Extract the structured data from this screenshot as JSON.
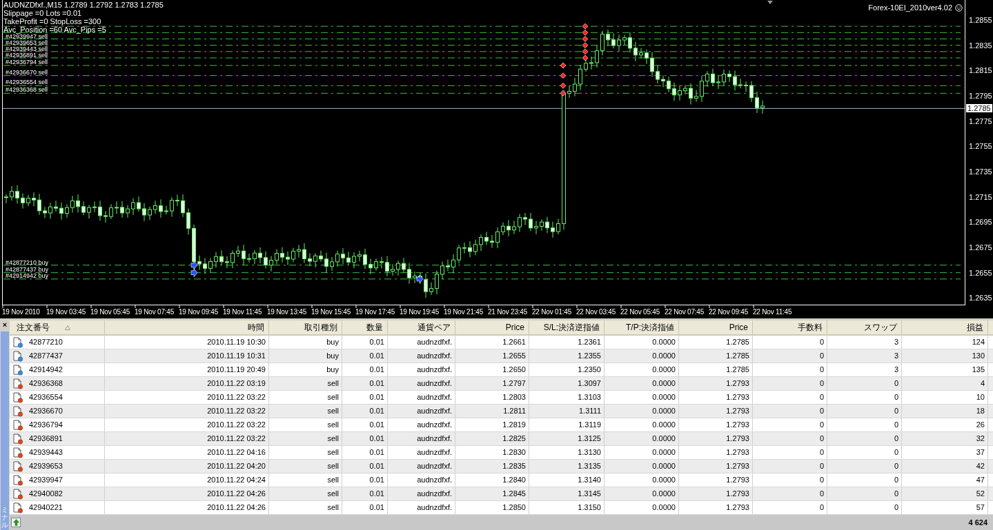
{
  "chart": {
    "symbol_line": "AUDNZDfxf.,M15  1.2789 1.2792 1.2783 1.2785",
    "info_lines": [
      "Slippage =0 Lots =0.01",
      "TakeProfit =0 StopLoss =300",
      "Avc_Position =60 Avc_Pips =5"
    ],
    "expert": "Forex-10EI_2010ver4.02",
    "price_ticks": [
      "1.2855",
      "1.2835",
      "1.2815",
      "1.2795",
      "1.2775",
      "1.2755",
      "1.2735",
      "1.2715",
      "1.2695",
      "1.2675",
      "1.2655",
      "1.2635"
    ],
    "current_price": "1.2785",
    "order_labels": [
      "#42939947 sell",
      "#42939653 sell",
      "#42939443 sell",
      "#42936891 sell",
      "#42936794 sell",
      "#42936670 sell",
      "#42936554 sell",
      "#42936368 sell",
      "#42877210 buy",
      "#42877437 buy",
      "#42914942 buy"
    ],
    "time_ticks": [
      "19 Nov 2010",
      "19 Nov 03:45",
      "19 Nov 05:45",
      "19 Nov 07:45",
      "19 Nov 09:45",
      "19 Nov 11:45",
      "19 Nov 13:45",
      "19 Nov 15:45",
      "19 Nov 17:45",
      "19 Nov 19:45",
      "19 Nov 21:45",
      "21 Nov 23:45",
      "22 Nov 01:45",
      "22 Nov 03:45",
      "22 Nov 05:45",
      "22 Nov 07:45",
      "22 Nov 09:45",
      "22 Nov 11:45"
    ]
  },
  "terminal": {
    "close": "×",
    "side_tab": "ミナル",
    "columns": [
      {
        "label": "注文番号",
        "sorted": true
      },
      {
        "label": "時間",
        "sorted": false
      },
      {
        "label": "取引種別",
        "sorted": false
      },
      {
        "label": "数量",
        "sorted": false
      },
      {
        "label": "通貨ペア",
        "sorted": false
      },
      {
        "label": "Price",
        "sorted": false
      },
      {
        "label": "S/L:決済逆指値",
        "sorted": false
      },
      {
        "label": "T/P:決済指値",
        "sorted": false
      },
      {
        "label": "Price",
        "sorted": false
      },
      {
        "label": "手数料",
        "sorted": false
      },
      {
        "label": "スワップ",
        "sorted": false
      },
      {
        "label": "損益",
        "sorted": false
      }
    ],
    "rows": [
      {
        "kind": "buy",
        "order": "42877210",
        "time": "2010.11.19 10:30",
        "type": "buy",
        "lots": "0.01",
        "symbol": "audnzdfxf.",
        "price": "1.2661",
        "sl": "1.2361",
        "tp": "0.0000",
        "current": "1.2785",
        "commission": "0",
        "swap": "3",
        "profit": "124"
      },
      {
        "kind": "buy",
        "order": "42877437",
        "time": "2010.11.19 10:31",
        "type": "buy",
        "lots": "0.01",
        "symbol": "audnzdfxf.",
        "price": "1.2655",
        "sl": "1.2355",
        "tp": "0.0000",
        "current": "1.2785",
        "commission": "0",
        "swap": "3",
        "profit": "130"
      },
      {
        "kind": "buy",
        "order": "42914942",
        "time": "2010.11.19 20:49",
        "type": "buy",
        "lots": "0.01",
        "symbol": "audnzdfxf.",
        "price": "1.2650",
        "sl": "1.2350",
        "tp": "0.0000",
        "current": "1.2785",
        "commission": "0",
        "swap": "3",
        "profit": "135"
      },
      {
        "kind": "sell",
        "order": "42936368",
        "time": "2010.11.22 03:19",
        "type": "sell",
        "lots": "0.01",
        "symbol": "audnzdfxf.",
        "price": "1.2797",
        "sl": "1.3097",
        "tp": "0.0000",
        "current": "1.2793",
        "commission": "0",
        "swap": "0",
        "profit": "4"
      },
      {
        "kind": "sell",
        "order": "42936554",
        "time": "2010.11.22 03:22",
        "type": "sell",
        "lots": "0.01",
        "symbol": "audnzdfxf.",
        "price": "1.2803",
        "sl": "1.3103",
        "tp": "0.0000",
        "current": "1.2793",
        "commission": "0",
        "swap": "0",
        "profit": "10"
      },
      {
        "kind": "sell",
        "order": "42936670",
        "time": "2010.11.22 03:22",
        "type": "sell",
        "lots": "0.01",
        "symbol": "audnzdfxf.",
        "price": "1.2811",
        "sl": "1.3111",
        "tp": "0.0000",
        "current": "1.2793",
        "commission": "0",
        "swap": "0",
        "profit": "18"
      },
      {
        "kind": "sell",
        "order": "42936794",
        "time": "2010.11.22 03:22",
        "type": "sell",
        "lots": "0.01",
        "symbol": "audnzdfxf.",
        "price": "1.2819",
        "sl": "1.3119",
        "tp": "0.0000",
        "current": "1.2793",
        "commission": "0",
        "swap": "0",
        "profit": "26"
      },
      {
        "kind": "sell",
        "order": "42936891",
        "time": "2010.11.22 03:22",
        "type": "sell",
        "lots": "0.01",
        "symbol": "audnzdfxf.",
        "price": "1.2825",
        "sl": "1.3125",
        "tp": "0.0000",
        "current": "1.2793",
        "commission": "0",
        "swap": "0",
        "profit": "32"
      },
      {
        "kind": "sell",
        "order": "42939443",
        "time": "2010.11.22 04:16",
        "type": "sell",
        "lots": "0.01",
        "symbol": "audnzdfxf.",
        "price": "1.2830",
        "sl": "1.3130",
        "tp": "0.0000",
        "current": "1.2793",
        "commission": "0",
        "swap": "0",
        "profit": "37"
      },
      {
        "kind": "sell",
        "order": "42939653",
        "time": "2010.11.22 04:20",
        "type": "sell",
        "lots": "0.01",
        "symbol": "audnzdfxf.",
        "price": "1.2835",
        "sl": "1.3135",
        "tp": "0.0000",
        "current": "1.2793",
        "commission": "0",
        "swap": "0",
        "profit": "42"
      },
      {
        "kind": "sell",
        "order": "42939947",
        "time": "2010.11.22 04:24",
        "type": "sell",
        "lots": "0.01",
        "symbol": "audnzdfxf.",
        "price": "1.2840",
        "sl": "1.3140",
        "tp": "0.0000",
        "current": "1.2793",
        "commission": "0",
        "swap": "0",
        "profit": "47"
      },
      {
        "kind": "sell",
        "order": "42940082",
        "time": "2010.11.22 04:26",
        "type": "sell",
        "lots": "0.01",
        "symbol": "audnzdfxf.",
        "price": "1.2845",
        "sl": "1.3145",
        "tp": "0.0000",
        "current": "1.2793",
        "commission": "0",
        "swap": "0",
        "profit": "52"
      },
      {
        "kind": "sell",
        "order": "42940221",
        "time": "2010.11.22 04:26",
        "type": "sell",
        "lots": "0.01",
        "symbol": "audnzdfxf.",
        "price": "1.2850",
        "sl": "1.3150",
        "tp": "0.0000",
        "current": "1.2793",
        "commission": "0",
        "swap": "0",
        "profit": "57"
      }
    ],
    "total": "4 624"
  }
}
